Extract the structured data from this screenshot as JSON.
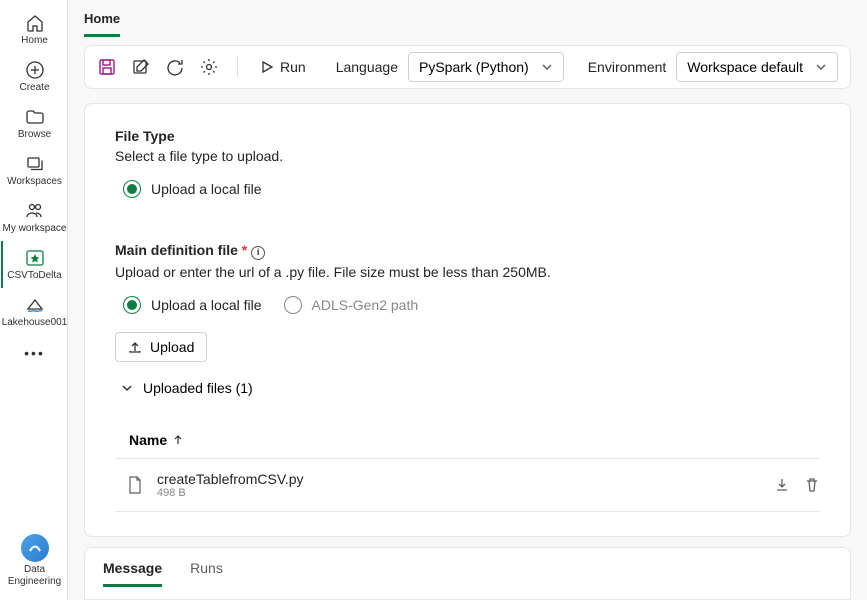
{
  "leftnav": {
    "items": [
      {
        "label": "Home",
        "icon": "home"
      },
      {
        "label": "Create",
        "icon": "plus-circle"
      },
      {
        "label": "Browse",
        "icon": "folder"
      },
      {
        "label": "Workspaces",
        "icon": "stack"
      },
      {
        "label": "My workspace",
        "icon": "people"
      },
      {
        "label": "CSVToDelta",
        "icon": "spark",
        "active": true
      },
      {
        "label": "Lakehouse001",
        "icon": "lakehouse"
      }
    ],
    "footer": {
      "label": "Data Engineering"
    }
  },
  "breadcrumb": "Home",
  "toolbar": {
    "run_label": "Run",
    "language_label": "Language",
    "language_value": "PySpark (Python)",
    "environment_label": "Environment",
    "environment_value": "Workspace default"
  },
  "fileType": {
    "title": "File Type",
    "desc": "Select a file type to upload.",
    "option1": "Upload a local file"
  },
  "mainDef": {
    "title": "Main definition file",
    "desc": "Upload or enter the url of a .py file. File size must be less than 250MB.",
    "option1": "Upload a local file",
    "option2": "ADLS-Gen2 path",
    "upload_btn": "Upload",
    "uploaded_label": "Uploaded files (1)",
    "col_name": "Name",
    "file": {
      "name": "createTablefromCSV.py",
      "size": "498 B"
    }
  },
  "bottomTabs": {
    "tab1": "Message",
    "tab2": "Runs"
  }
}
